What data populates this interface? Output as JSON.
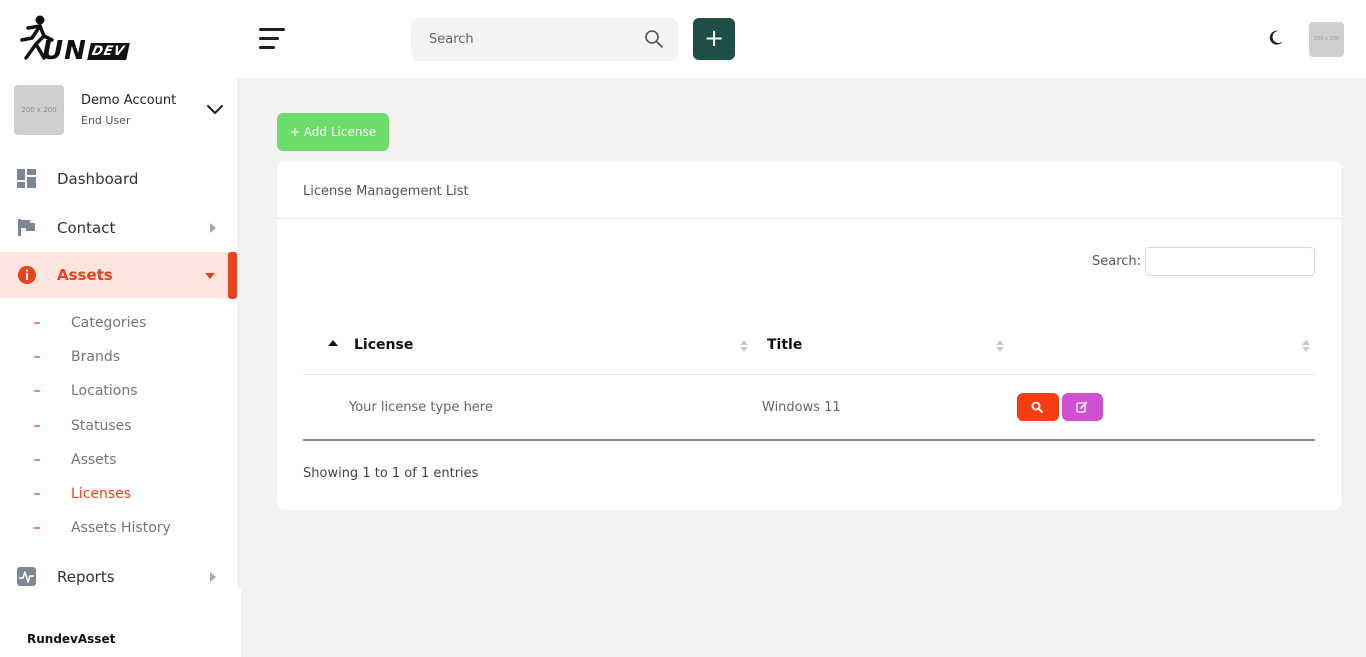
{
  "brand": {
    "logo_main": "UN",
    "logo_r": "R",
    "logo_dev": "DEV",
    "footer": "RundevAsset"
  },
  "header": {
    "search_placeholder": "Search",
    "avatar_placeholder": "200 x 200",
    "add_icon": "+"
  },
  "account": {
    "name": "Demo Account",
    "role": "End User",
    "avatar_placeholder": "200 x 200"
  },
  "nav": {
    "dashboard": "Dashboard",
    "contact": "Contact",
    "assets": "Assets",
    "reports": "Reports"
  },
  "assets_sub": {
    "categories": "Categories",
    "brands": "Brands",
    "locations": "Locations",
    "statuses": "Statuses",
    "assets": "Assets",
    "licenses": "Licenses",
    "history": "Assets History"
  },
  "main": {
    "add_license_label": "+ Add License",
    "card_title": "License Management List",
    "search_label": "Search:",
    "columns": [
      "License",
      "Title",
      ""
    ],
    "rows": [
      {
        "license": "Your license type here",
        "title": "Windows 11"
      }
    ],
    "info": "Showing 1 to 1 of 1 entries"
  },
  "colors": {
    "accent": "#e8431b",
    "add_button": "#1d4f46",
    "add_license": "#6cdc6a",
    "view_button": "#f43d12",
    "edit_button": "#d04fd2"
  }
}
